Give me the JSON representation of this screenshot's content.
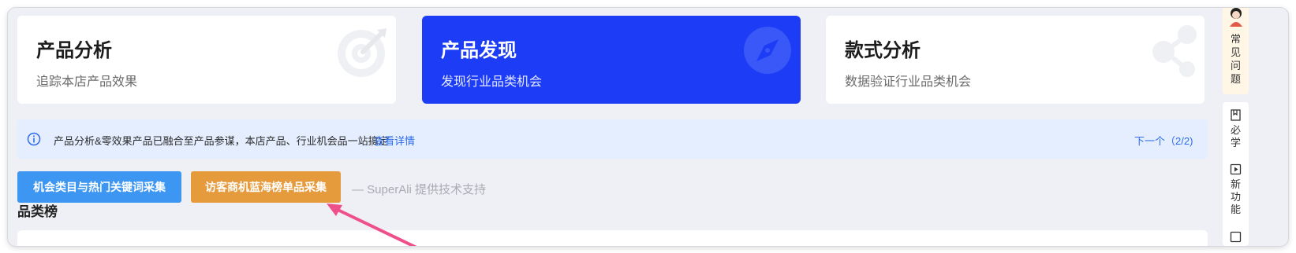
{
  "cards": [
    {
      "title": "产品分析",
      "subtitle": "追踪本店产品效果",
      "icon": "target-icon"
    },
    {
      "title": "产品发现",
      "subtitle": "发现行业品类机会",
      "icon": "compass-icon",
      "active": true
    },
    {
      "title": "款式分析",
      "subtitle": "数据验证行业品类机会",
      "icon": "share-nodes-icon"
    }
  ],
  "notice": {
    "message": "产品分析&零效果产品已融合至产品参谋，本店产品、行业机会品一站搞定",
    "link": "查看详情",
    "next": "下一个（2/2)"
  },
  "actions": {
    "collect_keywords": "机会类目与热门关键词采集",
    "collect_bluesea": "访客商机蓝海榜单品采集",
    "credit": "— SuperAli 提供技术支持"
  },
  "section_title": "品类榜",
  "sidebar": {
    "faq": [
      "常",
      "见",
      "问",
      "题"
    ],
    "must_learn": [
      "必",
      "学"
    ],
    "new_features": [
      "新",
      "功",
      "能"
    ]
  },
  "colors": {
    "accent": "#1d3cf5",
    "button_blue": "#3d96f2",
    "button_orange": "#e59a3c",
    "notice_bg": "#e4eeff",
    "arrow": "#f0508a"
  }
}
